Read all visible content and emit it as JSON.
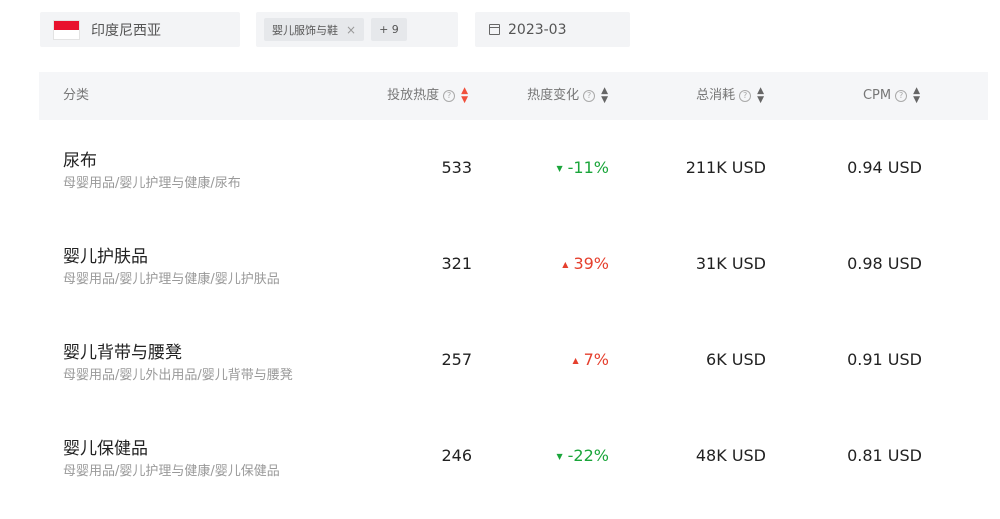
{
  "filters": {
    "country": "印度尼西亚",
    "category_tag": "婴儿服饰与鞋",
    "category_tag_close": "×",
    "more_count": "+ 9",
    "date": "2023-03"
  },
  "colors": {
    "flag_red": "#e8112d",
    "up": "#e53f2d",
    "down": "#1aa53a",
    "sort_active": "#f0503c"
  },
  "table": {
    "headers": {
      "category": "分类",
      "heat": "投放热度",
      "change": "热度变化",
      "cost": "总消耗",
      "cpm": "CPM"
    },
    "help_glyph": "?",
    "rows": [
      {
        "name": "尿布",
        "path": "母婴用品/婴儿护理与健康/尿布",
        "heat": "533",
        "change": "-11%",
        "trend": "down",
        "cost": "211K USD",
        "cpm": "0.94 USD"
      },
      {
        "name": "婴儿护肤品",
        "path": "母婴用品/婴儿护理与健康/婴儿护肤品",
        "heat": "321",
        "change": "39%",
        "trend": "up",
        "cost": "31K USD",
        "cpm": "0.98 USD"
      },
      {
        "name": "婴儿背带与腰凳",
        "path": "母婴用品/婴儿外出用品/婴儿背带与腰凳",
        "heat": "257",
        "change": "7%",
        "trend": "up",
        "cost": "6K USD",
        "cpm": "0.91 USD"
      },
      {
        "name": "婴儿保健品",
        "path": "母婴用品/婴儿护理与健康/婴儿保健品",
        "heat": "246",
        "change": "-22%",
        "trend": "down",
        "cost": "48K USD",
        "cpm": "0.81 USD"
      }
    ]
  }
}
